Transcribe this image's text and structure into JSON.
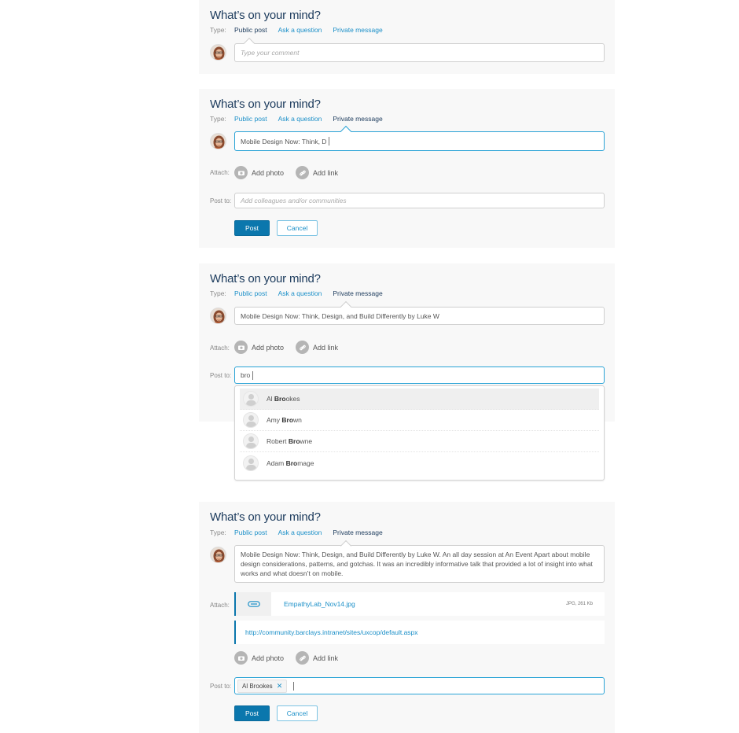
{
  "composer": {
    "title": "What’s on your mind?",
    "type_label": "Type:",
    "tabs": [
      "Public post",
      "Ask a question",
      "Private message"
    ],
    "attach_label": "Attach:",
    "post_to_label": "Post to:",
    "add_photo": "Add photo",
    "add_link": "Add link",
    "post_button": "Post",
    "cancel_button": "Cancel",
    "comment_placeholder": "Type your comment",
    "post_to_placeholder": "Add colleagues and/or communities"
  },
  "states": [
    {
      "active_tab": "Public post",
      "message": ""
    },
    {
      "active_tab": "Private message",
      "message": "Mobile Design Now: Think, D",
      "post_to": ""
    },
    {
      "active_tab": "Private message",
      "message": "Mobile Design Now: Think, Design, and Build Differently by Luke W",
      "post_to": "bro"
    },
    {
      "active_tab": "Private message",
      "message": "Mobile Design Now: Think, Design, and Build Differently by Luke W. An all day session at An Event Apart about mobile design considerations, patterns, and gotchas. It was an incredibly informative talk that provided a lot of insight into what works and what doesn’t on mobile.",
      "attachment": {
        "filename": "EmpathyLab_Nov14.jpg",
        "meta": "JPG, 261 Kb"
      },
      "link": "http://community.barclays.intranet/sites/uxcop/default.aspx",
      "recipient_chip": "Al Brookes"
    }
  ],
  "suggestions": [
    {
      "pre": "Al ",
      "match": "Bro",
      "post": "okes",
      "highlighted": true
    },
    {
      "pre": "Amy ",
      "match": "Bro",
      "post": "wn",
      "highlighted": false
    },
    {
      "pre": "Robert ",
      "match": "Bro",
      "post": "wne",
      "highlighted": false
    },
    {
      "pre": "Adam ",
      "match": "Bro",
      "post": "mage",
      "highlighted": false
    }
  ],
  "colors": {
    "accent": "#1a8fc8",
    "primary_button": "#0b77ad",
    "focus_border": "#2aa3d6",
    "title": "#1b3a5c",
    "panel_bg": "#f8f8f8"
  }
}
